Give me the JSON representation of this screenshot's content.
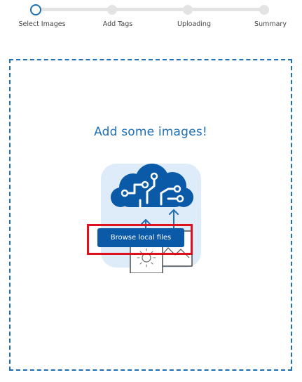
{
  "stepper": {
    "steps": [
      {
        "label": "Select Images",
        "state": "active"
      },
      {
        "label": "Add Tags",
        "state": "pending"
      },
      {
        "label": "Uploading",
        "state": "pending"
      },
      {
        "label": "Summary",
        "state": "pending"
      }
    ]
  },
  "dropzone": {
    "heading": "Add some images!",
    "browse_button_label": "Browse local files",
    "illustration_icon": "cloud-brain-upload-icon"
  },
  "colors": {
    "accent": "#1f6fb4",
    "button": "#0a5aa8",
    "highlight": "#e0111f",
    "track": "#e3e3e3"
  }
}
